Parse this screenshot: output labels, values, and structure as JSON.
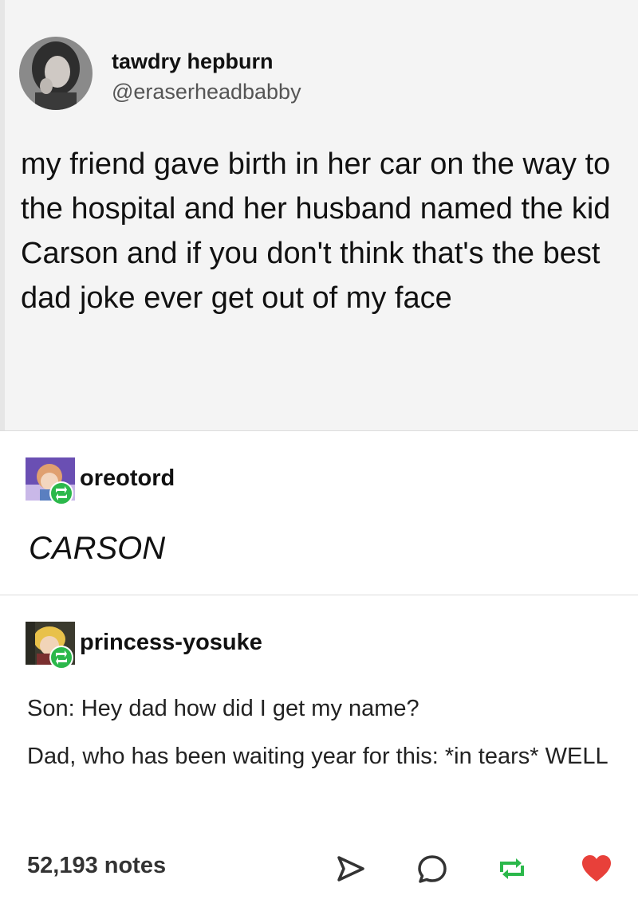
{
  "original_post": {
    "display_name": "tawdry hepburn",
    "handle": "@eraserheadbabby",
    "text": "my friend gave birth in her car on the way to the hospital and her husband named the kid Carson and if you don't think that's the best dad joke ever get out of my face"
  },
  "reblog_1": {
    "username": "oreotord",
    "text": "CARSON",
    "badge_icon": "reblog-icon",
    "accent": "#2bb84b"
  },
  "reblog_2": {
    "username": "princess-yosuke",
    "line_1": "Son: Hey dad how did I get my name?",
    "line_2": "Dad, who has been waiting year for this: *in tears* WELL",
    "badge_icon": "reblog-icon",
    "accent": "#2bb84b"
  },
  "footer": {
    "notes": "52,193 notes",
    "icons": [
      "share-icon",
      "reply-icon",
      "reblog-icon",
      "like-icon"
    ],
    "like_color": "#e8403a"
  }
}
